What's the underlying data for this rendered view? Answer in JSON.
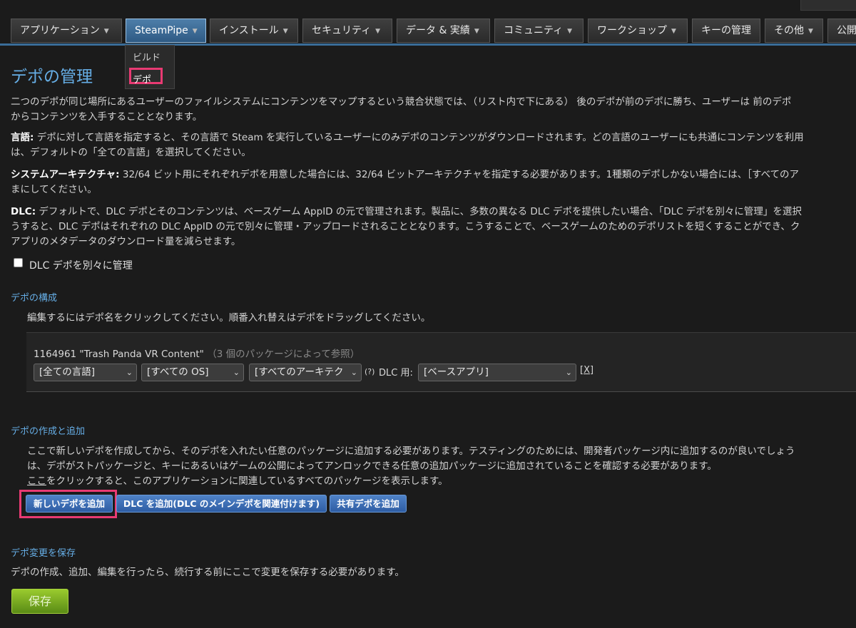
{
  "nav": {
    "tabs": [
      {
        "label": "アプリケーション"
      },
      {
        "label": "SteamPipe"
      },
      {
        "label": "インストール"
      },
      {
        "label": "セキュリティ"
      },
      {
        "label": "データ & 実績"
      },
      {
        "label": "コミュニティ"
      },
      {
        "label": "ワークショップ"
      },
      {
        "label": "キーの管理"
      },
      {
        "label": "その他"
      },
      {
        "label": "公開"
      }
    ],
    "dropdown": {
      "build": "ビルド",
      "depot": "デポ"
    }
  },
  "page": {
    "title": "デポの管理",
    "intro": [
      "二つのデポが同じ場所にあるユーザーのファイルシステムにコンテンツをマップするという競合状態では、（リスト内で下にある） 後のデポが前のデポに勝ち、ユーザーは 前のデポ",
      "からコンテンツを入手することとなります。"
    ],
    "lang_label": "言語:",
    "lang_text": [
      " デポに対して言語を指定すると、その言語で Steam を実行しているユーザーにのみデポのコンテンツがダウンロードされます。どの言語のユーザーにも共通にコンテンツを利用",
      "は、デフォルトの「全ての言語」を選択してください。"
    ],
    "arch_label": "システムアーキテクチャ:",
    "arch_text": [
      " 32/64 ビット用にそれぞれデポを用意した場合には、32/64 ビットアーキテクチャを指定する必要があります。1種類のデポしかない場合には、［すべてのア",
      "まにしてください。"
    ],
    "dlc_label": "DLC:",
    "dlc_text": [
      " デフォルトで、DLC デポとそのコンテンツは、ベースゲーム AppID の元で管理されます。製品に、多数の異なる DLC デポを提供したい場合、「DLC デポを別々に管理」を選択",
      "うすると、DLC デポはそれぞれの DLC AppID の元で別々に管理・アップロードされることとなります。こうすることで、ベースゲームのためのデポリストを短くすることができ、ク",
      "アプリのメタデータのダウンロード量を減らせます。"
    ],
    "dlc_checkbox": "DLC デポを別々に管理"
  },
  "config": {
    "heading": "デポの構成",
    "instruction": "編集するにはデポ名をクリックしてください。順番入れ替えはデポをドラッグしてください。",
    "depot": {
      "id_name": "1164961 \"Trash Panda VR Content\"",
      "refs": "（3 個のパッケージによって参照）",
      "language": "[全ての言語]",
      "os": "[すべての OS]",
      "arch": "[すべてのアーキテク",
      "help": "(?)",
      "dlc_for_label": "DLC 用:",
      "dlc_for": "[ベースアプリ]",
      "remove": "[X]"
    }
  },
  "create": {
    "heading": "デポの作成と追加",
    "lines": [
      "ここで新しいデポを作成してから、そのデポを入れたい任意のパッケージに追加する必要があります。テスティングのためには、開発者パッケージ内に追加するのが良いでしょう",
      "は、デポがストパッケージと、キーにあるいはゲームの公開によってアンロックできる任意の追加パッケージに追加されていることを確認する必要があります。"
    ],
    "link": "ここ",
    "link_tail": "をクリックすると、このアプリケーションに関連しているすべてのパッケージを表示します。",
    "buttons": {
      "new_depot": "新しいデポを追加",
      "add_dlc": "DLC を追加(DLC のメインデポを関連付けます)",
      "shared": "共有デポを追加"
    }
  },
  "save": {
    "heading": "デポ変更を保存",
    "text": "デポの作成、追加、編集を行ったら、続行する前にここで変更を保存する必要があります。",
    "button": "保存"
  },
  "colors": {
    "accent": "#66aee6",
    "highlight": "#e93a73",
    "save_green": "#7bb32a",
    "button_blue": "#3f70b8"
  }
}
